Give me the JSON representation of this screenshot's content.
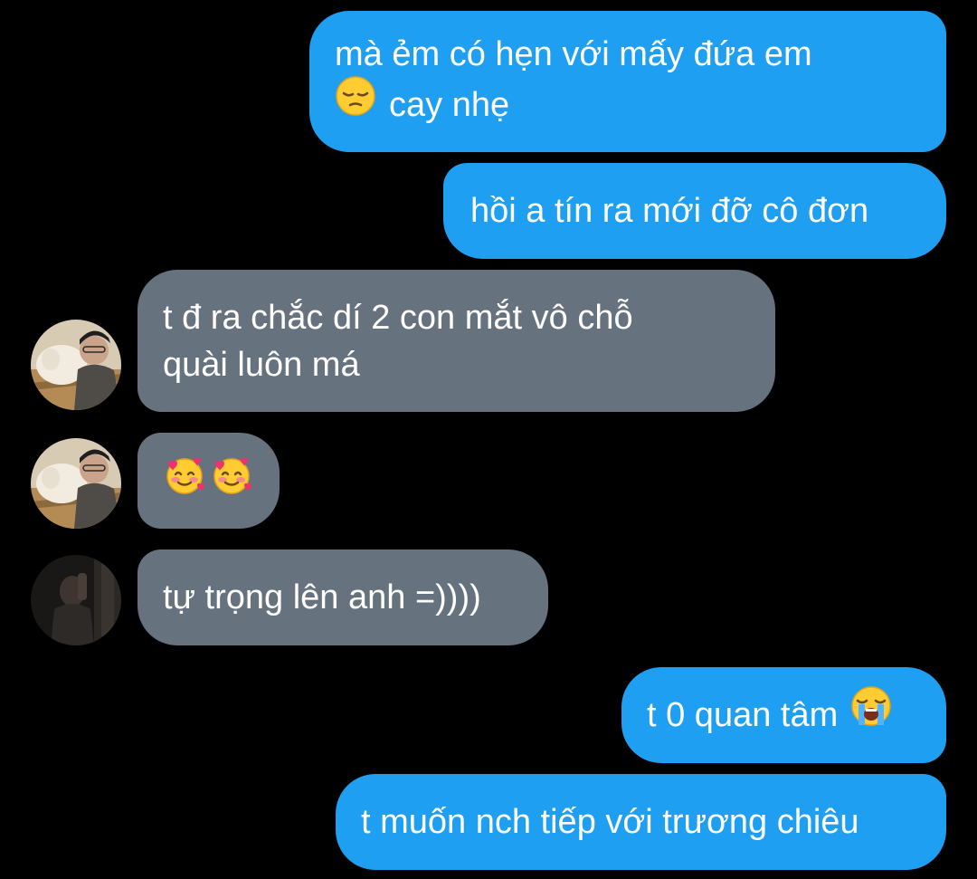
{
  "colors": {
    "background": "#000000",
    "sent_bubble": "#1e9ff2",
    "received_bubble": "#67727f",
    "text": "#ffffff"
  },
  "messages": [
    {
      "direction": "sent",
      "lines": [
        "mà ẻm có hẹn với mấy đứa em",
        "cay nhẹ"
      ],
      "emoji_before_line2": "pensive-face-icon"
    },
    {
      "direction": "sent",
      "text": "hồi a tín ra mới đỡ cô đơn"
    },
    {
      "direction": "received",
      "lines": [
        "t đ ra chắc dí 2 con mắt vô chỗ",
        "quài luôn má"
      ],
      "avatar": "user-photo-dog"
    },
    {
      "direction": "received",
      "emojis": [
        "smiling-face-with-hearts-icon",
        "smiling-face-with-hearts-icon"
      ],
      "avatar": "user-photo-dog"
    },
    {
      "direction": "received",
      "text": "tự trọng lên anh =))))",
      "avatar": "user-photo-dark"
    },
    {
      "direction": "sent",
      "text": "t 0 quan tâm",
      "emoji_after": "loudly-crying-face-icon"
    },
    {
      "direction": "sent",
      "text": "t muốn nch tiếp với trương chiêu"
    }
  ]
}
